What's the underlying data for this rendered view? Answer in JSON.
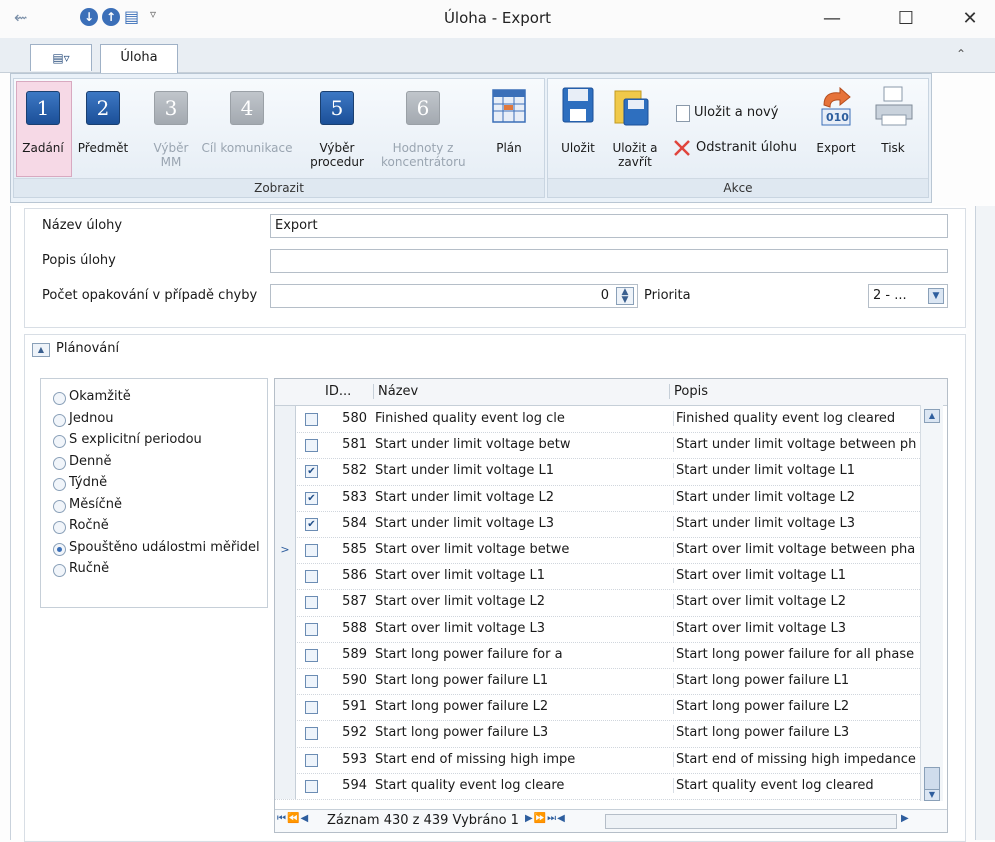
{
  "window": {
    "title": "Úloha - Export",
    "minimize_glyph": "—",
    "maximize_glyph": "☐",
    "close_glyph": "✕"
  },
  "quick_access": {
    "back_glyph": "⇜",
    "down_glyph": "↓",
    "up_glyph": "↑",
    "save_glyph": "▤",
    "dropdown_glyph": "▿"
  },
  "ribbon": {
    "menu_glyph": "▤▿",
    "tab_label": "Úloha",
    "collapse_glyph": "⌃",
    "zobrazit_group_label": "Zobrazit",
    "akce_group_label": "Akce",
    "steps": [
      {
        "number": "1",
        "label_line1": "Zadání",
        "label_line2": ""
      },
      {
        "number": "2",
        "label_line1": "Předmět",
        "label_line2": ""
      },
      {
        "number": "3",
        "label_line1": "Výběr",
        "label_line2": "MM"
      },
      {
        "number": "4",
        "label_line1": "Cíl komunikace",
        "label_line2": ""
      },
      {
        "number": "5",
        "label_line1": "Výběr",
        "label_line2": "procedur"
      },
      {
        "number": "6",
        "label_line1": "Hodnoty z",
        "label_line2": "koncentrátoru"
      }
    ],
    "plan_label": "Plán",
    "save_label": "Uložit",
    "save_close_line1": "Uložit a",
    "save_close_line2": "zavřít",
    "save_new_label": "Uložit a nový",
    "delete_label": "Odstranit úlohu",
    "export_label": "Export",
    "export_icon_text": "010",
    "print_label": "Tisk"
  },
  "form": {
    "name_label": "Název úlohy",
    "name_value": "Export",
    "desc_label": "Popis úlohy",
    "desc_value": "",
    "retry_label": "Počet opakování v případě chyby",
    "retry_value": "0",
    "priority_label": "Priorita",
    "priority_value": "2 - ..."
  },
  "planning": {
    "section_label": "Plánování",
    "options": [
      {
        "label": "Okamžitě",
        "selected": false
      },
      {
        "label": "Jednou",
        "selected": false
      },
      {
        "label": "S explicitní periodou",
        "selected": false
      },
      {
        "label": "Denně",
        "selected": false
      },
      {
        "label": "Týdně",
        "selected": false
      },
      {
        "label": "Měsíčně",
        "selected": false
      },
      {
        "label": "Ročně",
        "selected": false
      },
      {
        "label": "Spouštěno událostmi měřidel",
        "selected": true
      },
      {
        "label": "Ručně",
        "selected": false
      }
    ]
  },
  "grid": {
    "columns": {
      "id": "ID...",
      "name": "Název",
      "desc": "Popis"
    },
    "rows": [
      {
        "checked": false,
        "id": "580",
        "name": "Finished quality event log cle",
        "desc": "Finished quality event log cleared"
      },
      {
        "checked": false,
        "id": "581",
        "name": "Start under limit voltage betw",
        "desc": "Start under limit voltage between ph"
      },
      {
        "checked": true,
        "id": "582",
        "name": "Start under limit voltage L1",
        "desc": "Start under limit voltage L1"
      },
      {
        "checked": true,
        "id": "583",
        "name": "Start under limit voltage L2",
        "desc": "Start under limit voltage L2"
      },
      {
        "checked": true,
        "id": "584",
        "name": "Start under limit voltage L3",
        "desc": "Start under limit voltage L3"
      },
      {
        "checked": false,
        "id": "585",
        "name": "Start over limit voltage betwe",
        "desc": "Start over limit voltage between pha"
      },
      {
        "checked": false,
        "id": "586",
        "name": "Start over limit voltage L1",
        "desc": "Start over limit voltage L1"
      },
      {
        "checked": false,
        "id": "587",
        "name": "Start over limit voltage L2",
        "desc": "Start over limit voltage L2"
      },
      {
        "checked": false,
        "id": "588",
        "name": "Start over limit voltage L3",
        "desc": "Start over limit voltage L3"
      },
      {
        "checked": false,
        "id": "589",
        "name": "Start long power failure for a",
        "desc": "Start long power failure for all phase"
      },
      {
        "checked": false,
        "id": "590",
        "name": "Start long power failure L1",
        "desc": "Start long power failure L1"
      },
      {
        "checked": false,
        "id": "591",
        "name": "Start long power failure L2",
        "desc": "Start long power failure L2"
      },
      {
        "checked": false,
        "id": "592",
        "name": "Start long power failure L3",
        "desc": "Start long power failure L3"
      },
      {
        "checked": false,
        "id": "593",
        "name": "Start end of missing high impe",
        "desc": "Start end of missing high impedance"
      },
      {
        "checked": false,
        "id": "594",
        "name": "Start quality event log cleare",
        "desc": "Start quality event log cleared"
      }
    ],
    "current_row_index": 5,
    "current_row_marker": ">",
    "navigator_text": "Záznam 430 z 439 Vybráno 1"
  }
}
